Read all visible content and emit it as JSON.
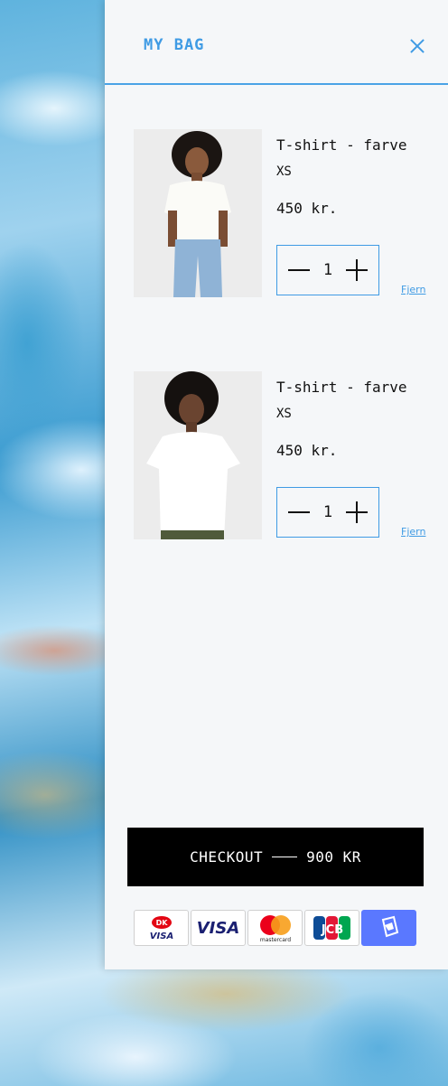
{
  "drawer": {
    "title": "MY BAG"
  },
  "items": [
    {
      "name": "T-shirt - farve",
      "size": "XS",
      "price": "450 kr.",
      "quantity": "1",
      "remove_label": "Fjern"
    },
    {
      "name": "T-shirt - farve",
      "size": "XS",
      "price": "450 kr.",
      "quantity": "1",
      "remove_label": "Fjern"
    }
  ],
  "checkout": {
    "label": "CHECKOUT",
    "total": "900 KR"
  },
  "payments": [
    {
      "icon": "dankort-icon",
      "label": "VISA"
    },
    {
      "icon": "visa-icon",
      "label": "VISA"
    },
    {
      "icon": "mastercard-icon",
      "label": "mastercard"
    },
    {
      "icon": "jcb-icon",
      "label": "JCB"
    },
    {
      "icon": "mobilepay-icon",
      "label": ""
    }
  ],
  "colors": {
    "accent": "#3f9be4",
    "panel": "#f5f7f9",
    "button": "#000000"
  }
}
